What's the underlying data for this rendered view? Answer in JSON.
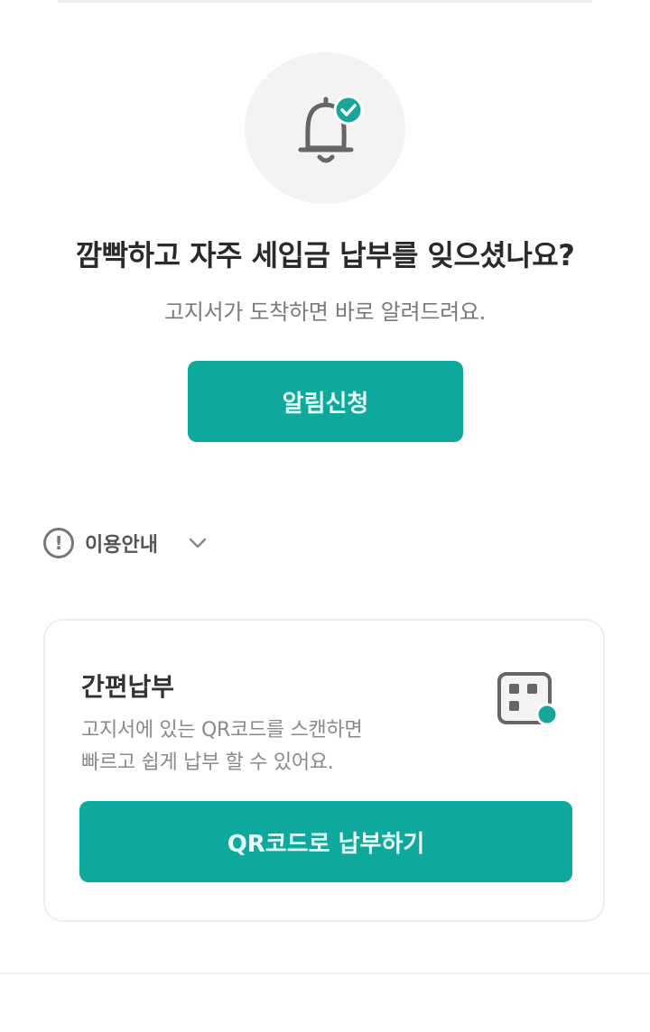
{
  "notice": {
    "icon": "bell-check-icon",
    "headline": "깜빡하고 자주 세입금 납부를 잊으셨나요?",
    "subline": "고지서가 도착하면 바로 알려드려요.",
    "subscribe_label": "알림신청"
  },
  "guide": {
    "icon": "info-circle-icon",
    "label": "이용안내",
    "toggle_icon": "chevron-down-icon"
  },
  "easy_pay": {
    "title": "간편납부",
    "desc_line1": "고지서에 있는 QR코드를 스캔하면",
    "desc_line2": "빠르고 쉽게 납부 할 수 있어요.",
    "icon": "qr-scan-icon",
    "button_label": "QR코드로 납부하기"
  },
  "colors": {
    "accent": "#0ea89c",
    "background": "#ffffff",
    "muted_text": "#7a7a7a"
  }
}
